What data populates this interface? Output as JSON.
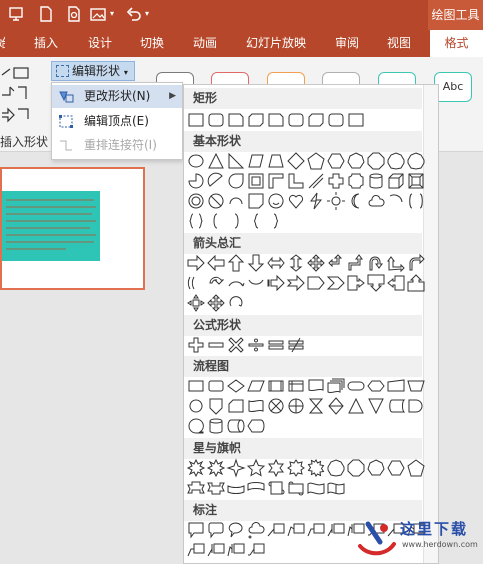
{
  "titlebar": {
    "tool_label": "绘图工具"
  },
  "tabs": [
    "插入",
    "设计",
    "切换",
    "动画",
    "幻灯片放映",
    "审阅",
    "视图"
  ],
  "active_tab": "格式",
  "ribbon": {
    "edit_shape": "编辑形状",
    "insert_shapes_label": "插入形状",
    "style_preview_text": "Abc",
    "style_colors": [
      "#7a7a7a",
      "#e06a6a",
      "#f0a050",
      "#b0b0b0",
      "#3cc6b4",
      "#3cc6b4"
    ]
  },
  "menu": {
    "items": [
      {
        "label": "更改形状(N)",
        "icon": "change-shape-icon"
      },
      {
        "label": "编辑顶点(E)",
        "icon": "edit-points-icon"
      },
      {
        "label": "重排连接符(I)",
        "icon": "reroute-connectors-icon"
      }
    ]
  },
  "gallery": {
    "categories": [
      "矩形",
      "基本形状",
      "箭头总汇",
      "公式形状",
      "流程图",
      "星与旗帜",
      "标注"
    ]
  },
  "watermark": {
    "text": "这里下载",
    "url": "www.herdown.com"
  },
  "colors": {
    "accent": "#b7472a",
    "menu_hover": "#d4dff0",
    "textbox": "#2ec4b6",
    "slide_border": "#e07050"
  }
}
